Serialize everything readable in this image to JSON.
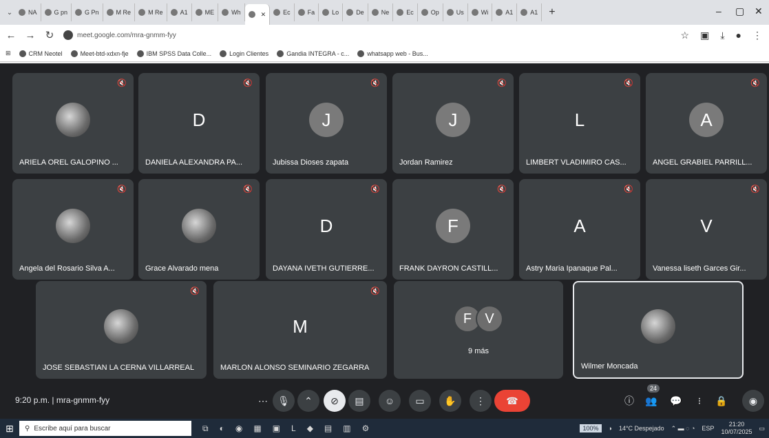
{
  "browser": {
    "tabs": [
      "NA",
      "G pn",
      "G Pn",
      "M Re",
      "M Re",
      "A1",
      "ME",
      "Wh",
      "",
      "Ec",
      "Fa",
      "Lo",
      "De",
      "Ne",
      "Ec",
      "Op",
      "Us",
      "Wi",
      "A1",
      "A1"
    ],
    "active_tab_index": 8,
    "url": "meet.google.com/mra-gnmm-fyy",
    "bookmarks": [
      "CRM Neotel",
      "Meet-btd-xdxn-fje",
      "IBM SPSS Data Colle...",
      "Login Clientes",
      "Gandia INTEGRA - c...",
      "whatsapp web - Bus..."
    ]
  },
  "meet": {
    "participants": [
      {
        "name": "ARIELA OREL GALOPINO ...",
        "avatar": "photo"
      },
      {
        "name": "DANIELA ALEXANDRA PA...",
        "avatar": "D"
      },
      {
        "name": "Jubissa Dioses zapata",
        "avatar": "J"
      },
      {
        "name": "Jordan Ramirez",
        "avatar": "J"
      },
      {
        "name": "LIMBERT VLADIMIRO CAS...",
        "avatar": "L"
      },
      {
        "name": "ANGEL GRABIEL PARRILL...",
        "avatar": "A"
      },
      {
        "name": "Angela del Rosario Silva A...",
        "avatar": "photo"
      },
      {
        "name": "Grace Alvarado mena",
        "avatar": "photo"
      },
      {
        "name": "DAYANA IVETH GUTIERRE...",
        "avatar": "D"
      },
      {
        "name": "FRANK DAYRON CASTILL...",
        "avatar": "F"
      },
      {
        "name": "Astry Maria Ipanaque Pal...",
        "avatar": "A"
      },
      {
        "name": "Vanessa liseth Garces Gir...",
        "avatar": "V"
      },
      {
        "name": "JOSE SEBASTIAN LA CERNA VILLARREAL",
        "avatar": "photo"
      },
      {
        "name": "MARLON ALONSO SEMINARIO ZEGARRA",
        "avatar": "M"
      },
      {
        "name": "Wilmer Moncada",
        "avatar": "photo"
      }
    ],
    "more": {
      "avatars": [
        "F",
        "V"
      ],
      "label": "9 más"
    },
    "time": "9:20 p.m.",
    "separator": "|",
    "meeting_code": "mra-gnmm-fyy",
    "people_count": "24",
    "toolbar_icons": [
      "more-options-icon",
      "mic-icon",
      "chevron-up-icon",
      "camera-off-icon",
      "captions-icon",
      "emoji-icon",
      "present-icon",
      "raise-hand-icon",
      "more-vert-icon",
      "end-call-icon"
    ],
    "right_icons": [
      "info-icon",
      "people-icon",
      "chat-icon",
      "activities-icon",
      "host-controls-icon",
      "profile-icon"
    ],
    "colors": {
      "background": "#202124",
      "tile": "#3c4043",
      "end_call": "#ea4335"
    }
  },
  "taskbar": {
    "search_placeholder": "Escribe aquí para buscar",
    "zoom": "100%",
    "weather": "14°C Despejado",
    "lang": "ESP",
    "time": "21:20",
    "date": "10/07/2025"
  }
}
